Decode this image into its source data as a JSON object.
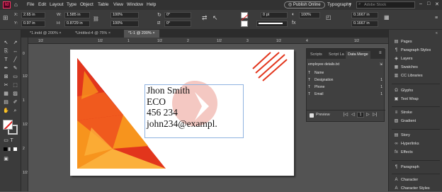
{
  "app": {
    "logo": "Id"
  },
  "menu": [
    "File",
    "Edit",
    "Layout",
    "Type",
    "Object",
    "Table",
    "View",
    "Window",
    "Help"
  ],
  "header": {
    "publish": "Publish Online",
    "workspace": "Typography",
    "search_placeholder": "Adobe Stock"
  },
  "control": {
    "x_label": "X:",
    "x_value": "2.65 in",
    "y_label": "Y:",
    "y_value": "0.97 in",
    "w_label": "W:",
    "w_value": "1.585 in",
    "h_label": "H:",
    "h_value": "0.8729 in",
    "scale_x": "100%",
    "scale_y": "100%",
    "rotate": "0°",
    "shear": "0°",
    "stroke_weight": "0 pt",
    "percent": "100%",
    "size_a": "0.1667 in",
    "size_b": "0.1667 in"
  },
  "tabs": [
    "*1.indd @ 200%",
    "*Untitled-4 @ 75%",
    "*1-1 @ 200%"
  ],
  "ruler": {
    "top": [
      "1/2",
      "1/2",
      "1",
      "1/2",
      "2",
      "1/2",
      "3",
      "1/2",
      "4",
      "1/2"
    ],
    "left": [
      "0",
      "1/2",
      "1",
      "1/2",
      "2",
      "1/2"
    ]
  },
  "card": {
    "lines": [
      "Jhon Smith",
      "ECO",
      "456 234",
      "john234@exampl."
    ],
    "colors": {
      "dark": "#cc1f1a",
      "red": "#e2351c",
      "orange": "#f05a1e",
      "amber": "#f7941d",
      "yellow": "#fbb03b",
      "watermark": "#f4c8c2"
    }
  },
  "data_merge": {
    "tabs": [
      "Scripts",
      "Script La",
      "Data Merge"
    ],
    "source": "employee details.txt",
    "fields": [
      {
        "icon": "T",
        "name": "Name",
        "count": ""
      },
      {
        "icon": "T",
        "name": "Designation",
        "count": "1"
      },
      {
        "icon": "T",
        "name": "Phone",
        "count": "1"
      },
      {
        "icon": "T",
        "name": "Email",
        "count": "1"
      }
    ],
    "preview_label": "Preview",
    "record": "1"
  },
  "dock": {
    "group1": [
      {
        "icon": "pages-icon",
        "glyph": "▤",
        "label": "Pages"
      },
      {
        "icon": "paragraph-styles-icon",
        "glyph": "¶",
        "label": "Paragraph Styles"
      },
      {
        "icon": "layers-icon",
        "glyph": "◈",
        "label": "Layers"
      },
      {
        "icon": "swatches-icon",
        "glyph": "▦",
        "label": "Swatches"
      },
      {
        "icon": "cc-libraries-icon",
        "glyph": "▥",
        "label": "CC Libraries"
      }
    ],
    "group2": [
      {
        "icon": "glyphs-icon",
        "glyph": "Ω",
        "label": "Glyphs"
      },
      {
        "icon": "text-wrap-icon",
        "glyph": "▣",
        "label": "Text Wrap"
      }
    ],
    "group3": [
      {
        "icon": "stroke-icon",
        "glyph": "≡",
        "label": "Stroke"
      },
      {
        "icon": "gradient-icon",
        "glyph": "▨",
        "label": "Gradient"
      }
    ],
    "group4": [
      {
        "icon": "story-icon",
        "glyph": "▤",
        "label": "Story"
      },
      {
        "icon": "hyperlinks-icon",
        "glyph": "∞",
        "label": "Hyperlinks"
      },
      {
        "icon": "effects-icon",
        "glyph": "fx",
        "label": "Effects"
      }
    ],
    "group5": [
      {
        "icon": "paragraph-icon",
        "glyph": "¶",
        "label": "Paragraph"
      },
      {
        "icon": "character-icon",
        "glyph": "A",
        "label": "Character"
      },
      {
        "icon": "character-styles-icon",
        "glyph": "A",
        "label": "Character Styles"
      }
    ]
  }
}
